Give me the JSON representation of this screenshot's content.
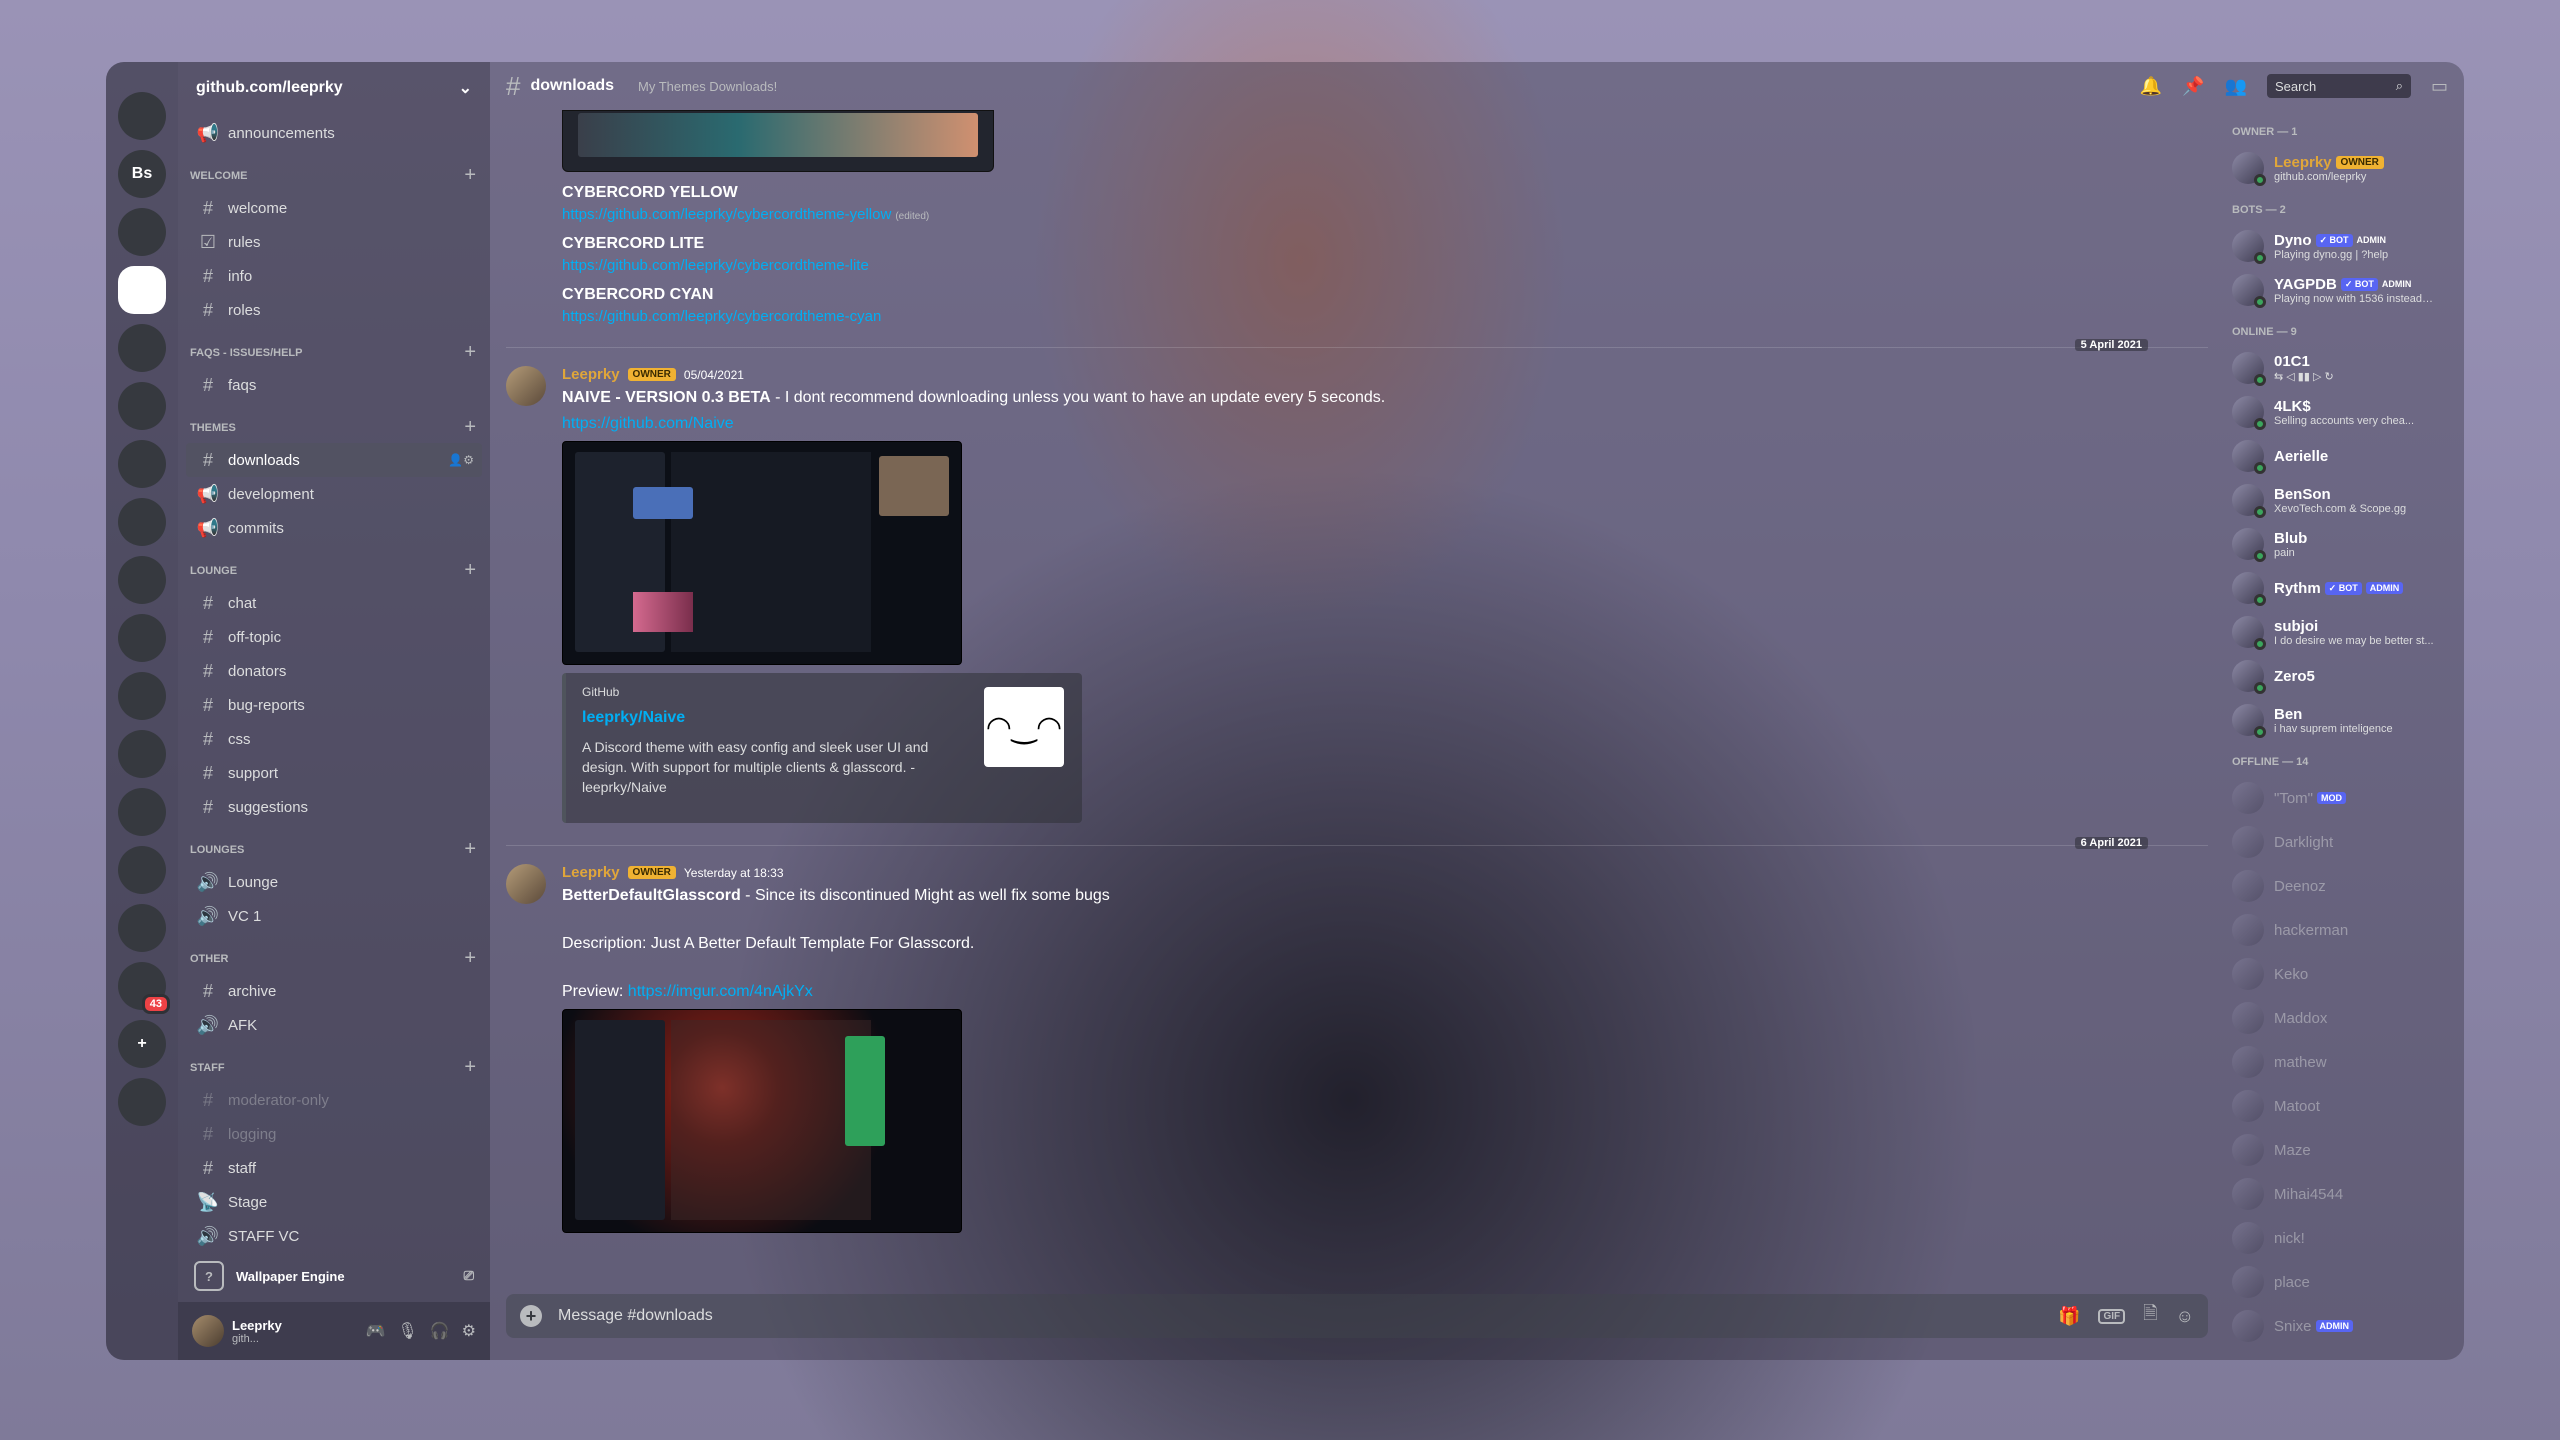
{
  "guild": {
    "name": "github.com/leeprky",
    "rail": [
      {
        "label": "",
        "icon": "discord-home-icon"
      },
      {
        "label": "Bs"
      },
      {
        "label": "",
        "icon": "server-icon"
      },
      {
        "label": "",
        "icon": "server-icon",
        "active": true
      },
      {
        "label": "",
        "icon": "server-icon"
      },
      {
        "label": "",
        "icon": "server-icon"
      },
      {
        "label": "",
        "icon": "folder-icon"
      },
      {
        "label": "",
        "icon": "server-icon"
      },
      {
        "label": "",
        "icon": "server-icon"
      },
      {
        "label": "",
        "icon": "server-icon"
      },
      {
        "label": "",
        "icon": "server-icon"
      },
      {
        "label": "",
        "icon": "folder-icon"
      },
      {
        "label": "",
        "icon": "server-icon"
      },
      {
        "label": "",
        "icon": "server-icon"
      },
      {
        "label": "",
        "icon": "server-icon"
      },
      {
        "label": "",
        "icon": "server-icon",
        "badge": "43"
      },
      {
        "label": "+",
        "icon": "add-server-icon"
      },
      {
        "label": "",
        "icon": "compass-icon"
      }
    ]
  },
  "channels": {
    "top": [
      {
        "label": "announcements",
        "glyph": "📢"
      }
    ],
    "categories": [
      {
        "name": "welcome",
        "items": [
          {
            "label": "welcome",
            "glyph": "#"
          },
          {
            "label": "rules",
            "glyph": "☑"
          },
          {
            "label": "info",
            "glyph": "#"
          },
          {
            "label": "roles",
            "glyph": "#"
          }
        ]
      },
      {
        "name": "faqs - issues/help",
        "items": [
          {
            "label": "faqs",
            "glyph": "#"
          }
        ]
      },
      {
        "name": "themes",
        "items": [
          {
            "label": "downloads",
            "glyph": "#"
          },
          {
            "label": "development",
            "glyph": "📢"
          },
          {
            "label": "commits",
            "glyph": "📢"
          }
        ]
      },
      {
        "name": "lounge",
        "items": [
          {
            "label": "chat",
            "glyph": "#"
          },
          {
            "label": "off-topic",
            "glyph": "#"
          },
          {
            "label": "donators",
            "glyph": "#"
          },
          {
            "label": "bug-reports",
            "glyph": "#"
          },
          {
            "label": "css",
            "glyph": "#"
          },
          {
            "label": "support",
            "glyph": "#"
          },
          {
            "label": "suggestions",
            "glyph": "#"
          }
        ]
      },
      {
        "name": "lounges",
        "items": [
          {
            "label": "Lounge",
            "glyph": "🔊"
          },
          {
            "label": "VC 1",
            "glyph": "🔊"
          }
        ]
      },
      {
        "name": "other",
        "items": [
          {
            "label": "archive",
            "glyph": "#"
          },
          {
            "label": "AFK",
            "glyph": "🔊"
          }
        ]
      },
      {
        "name": "staff",
        "items": [
          {
            "label": "moderator-only",
            "glyph": "#"
          },
          {
            "label": "logging",
            "glyph": "#"
          },
          {
            "label": "staff",
            "glyph": "#"
          },
          {
            "label": "Stage",
            "glyph": "📡"
          },
          {
            "label": "STAFF VC",
            "glyph": "🔊"
          }
        ]
      }
    ],
    "wallpaper_engine": "Wallpaper Engine",
    "user": {
      "name": "Leeprky",
      "sub": "gith..."
    }
  },
  "topbar": {
    "channel": "downloads",
    "topic": "My Themes Downloads!",
    "search_placeholder": "Search"
  },
  "messages": {
    "themes": [
      {
        "name": "CYBERCORD YELLOW",
        "url": "https://github.com/leeprky/cybercordtheme-yellow",
        "edited": "(edited)"
      },
      {
        "name": "CYBERCORD LITE",
        "url": "https://github.com/leeprky/cybercordtheme-lite",
        "edited": ""
      },
      {
        "name": "CYBERCORD CYAN",
        "url": "https://github.com/leeprky/cybercordtheme-cyan",
        "edited": ""
      }
    ],
    "divider1": "5 April 2021",
    "msg1": {
      "author": "Leeprky",
      "tag": "OWNER",
      "time": "05/04/2021",
      "title": "NAIVE - VERSION 0.3 BETA",
      "text": " - I dont recommend downloading unless you want to have an update every 5 seconds.",
      "url": "https://github.com/Naive",
      "embed": {
        "provider": "GitHub",
        "title": "leeprky/Naive",
        "desc": "A Discord theme with easy config and sleek user UI and design. With support for multiple clients & glasscord. - leeprky/Naive"
      }
    },
    "divider2": "6 April 2021",
    "msg2": {
      "author": "Leeprky",
      "tag": "OWNER",
      "time": "Yesterday at 18:33",
      "title": "BetterDefaultGlasscord",
      "text": " - Since its discontinued Might as well fix some bugs",
      "desc": "Description: Just A Better Default Template For Glasscord.",
      "preview_label": "Preview: ",
      "preview_url": "https://imgur.com/4nAjkYx"
    },
    "composer_placeholder": "Message #downloads"
  },
  "members": {
    "groups": [
      {
        "title": "OWNER — 1",
        "items": [
          {
            "name": "Leeprky",
            "tag": "OWNER",
            "sub": "github.com/leeprky",
            "owner": true
          }
        ]
      },
      {
        "title": "BOTS — 2",
        "items": [
          {
            "name": "Dyno",
            "bot": "✓ BOT",
            "admin": "ADMIN",
            "sub": "Playing dyno.gg | ?help"
          },
          {
            "name": "YAGPDB",
            "bot": "✓ BOT",
            "admin": "ADMIN",
            "sub": "Playing now with 1536 instead ..."
          }
        ]
      },
      {
        "title": "ONLINE — 9",
        "items": [
          {
            "name": "01C1",
            "sub": "⇆  ◁  ▮▮  ▷  ↻"
          },
          {
            "name": "4LK$",
            "sub": "Selling accounts very chea..."
          },
          {
            "name": "Aerielle",
            "sub": ""
          },
          {
            "name": "BenSon",
            "sub": "XevoTech.com & Scope.gg"
          },
          {
            "name": "Blub",
            "sub": "pain"
          },
          {
            "name": "Rythm",
            "bot": "✓ BOT",
            "adminTag": "ADMIN",
            "sub": ""
          },
          {
            "name": "subjoi",
            "sub": "I do desire we may be better st..."
          },
          {
            "name": "Zero5",
            "sub": ""
          },
          {
            "name": "Ben",
            "sub": "i hav suprem inteligence"
          }
        ]
      },
      {
        "title": "OFFLINE — 14",
        "items": [
          {
            "name": "\"Tom\"",
            "adminTag": "MOD",
            "off": true
          },
          {
            "name": "Darklight",
            "off": true
          },
          {
            "name": "Deenoz",
            "off": true
          },
          {
            "name": "hackerman",
            "off": true
          },
          {
            "name": "Keko",
            "off": true
          },
          {
            "name": "Maddox",
            "off": true
          },
          {
            "name": "mathew",
            "off": true
          },
          {
            "name": "Matoot",
            "off": true
          },
          {
            "name": "Maze",
            "off": true
          },
          {
            "name": "Mihai4544",
            "off": true
          },
          {
            "name": "nick!",
            "off": true
          },
          {
            "name": "place",
            "off": true
          },
          {
            "name": "Snixe",
            "adminTag": "ADMIN",
            "off": true
          }
        ]
      }
    ]
  }
}
